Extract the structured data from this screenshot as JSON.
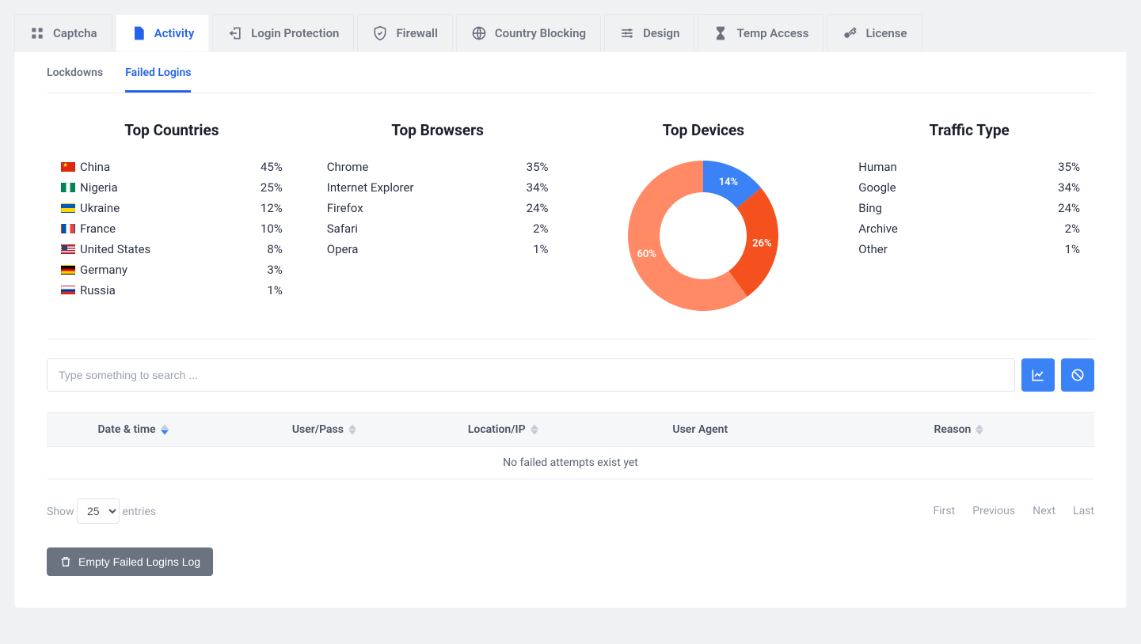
{
  "tabs": {
    "captcha": "Captcha",
    "activity": "Activity",
    "login_protection": "Login Protection",
    "firewall": "Firewall",
    "country_blocking": "Country Blocking",
    "design": "Design",
    "temp_access": "Temp Access",
    "license": "License"
  },
  "subtabs": {
    "lockdowns": "Lockdowns",
    "failed_logins": "Failed Logins"
  },
  "top_countries": {
    "title": "Top Countries",
    "rows": [
      {
        "label": "China",
        "value": "45%"
      },
      {
        "label": "Nigeria",
        "value": "25%"
      },
      {
        "label": "Ukraine",
        "value": "12%"
      },
      {
        "label": "France",
        "value": "10%"
      },
      {
        "label": "United States",
        "value": "8%"
      },
      {
        "label": "Germany",
        "value": "3%"
      },
      {
        "label": "Russia",
        "value": "1%"
      }
    ]
  },
  "top_browsers": {
    "title": "Top Browsers",
    "rows": [
      {
        "label": "Chrome",
        "value": "35%"
      },
      {
        "label": "Internet Explorer",
        "value": "34%"
      },
      {
        "label": "Firefox",
        "value": "24%"
      },
      {
        "label": "Safari",
        "value": "2%"
      },
      {
        "label": "Opera",
        "value": "1%"
      }
    ]
  },
  "top_devices": {
    "title": "Top Devices"
  },
  "traffic_type": {
    "title": "Traffic Type",
    "rows": [
      {
        "label": "Human",
        "value": "35%"
      },
      {
        "label": "Google",
        "value": "34%"
      },
      {
        "label": "Bing",
        "value": "24%"
      },
      {
        "label": "Archive",
        "value": "2%"
      },
      {
        "label": "Other",
        "value": "1%"
      }
    ]
  },
  "chart_data": {
    "type": "pie",
    "title": "Top Devices",
    "slices": [
      {
        "name": "slice-a",
        "value": 14,
        "color": "#3b82f6"
      },
      {
        "name": "slice-b",
        "value": 26,
        "color": "#f4511e"
      },
      {
        "name": "slice-c",
        "value": 60,
        "color": "#ff8a65"
      }
    ],
    "labels": [
      "14%",
      "26%",
      "60%"
    ]
  },
  "search": {
    "placeholder": "Type something to search ..."
  },
  "table": {
    "columns": {
      "date": "Date & time",
      "user": "User/Pass",
      "location": "Location/IP",
      "agent": "User Agent",
      "reason": "Reason"
    },
    "empty": "No failed attempts exist yet"
  },
  "footer": {
    "show": "Show",
    "entries_val": "25",
    "entries": "entries",
    "first": "First",
    "previous": "Previous",
    "next": "Next",
    "last": "Last"
  },
  "empty_button": "Empty Failed Logins Log"
}
